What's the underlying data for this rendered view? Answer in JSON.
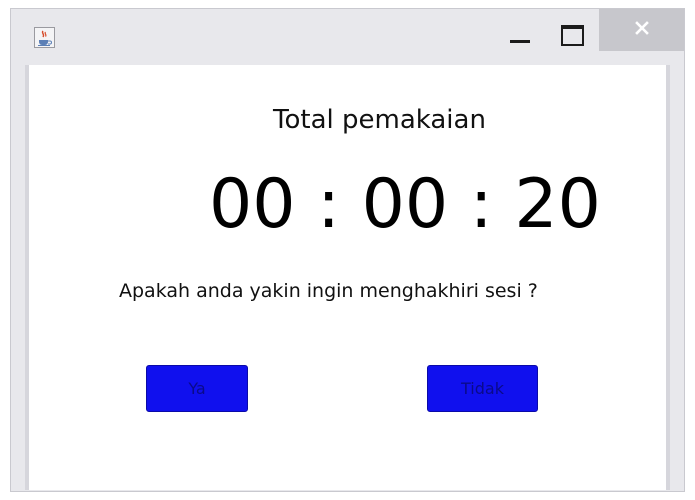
{
  "window": {
    "controls": {
      "minimize_icon": "minimize-icon",
      "maximize_icon": "maximize-icon",
      "close_icon": "close-icon"
    },
    "app_icon": "java-cup-icon"
  },
  "dialog": {
    "title_label": "Total pemakaian",
    "timer": "00 : 00 : 20",
    "question": "Apakah anda yakin ingin menghakhiri sesi ?",
    "yes_label": "Ya",
    "no_label": "Tidak"
  },
  "colors": {
    "button_bg": "#1010ee",
    "button_text": "#0a0a8a",
    "titlebar": "#e8e8ec",
    "close_button": "#c7c7cc"
  }
}
